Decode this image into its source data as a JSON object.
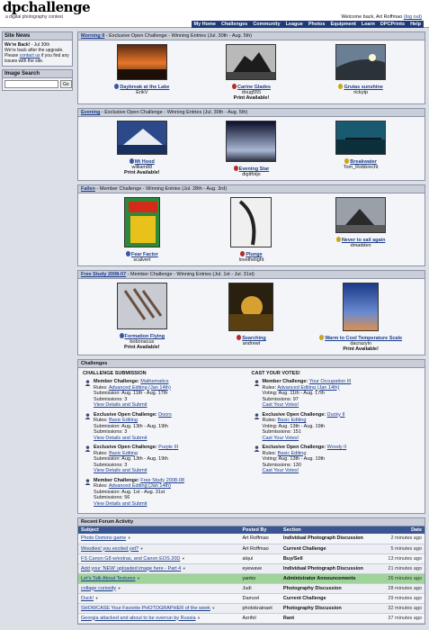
{
  "header": {
    "brand": "dpchallenge",
    "tagline": "a digital photography contest",
    "welcome": "Welcome back, Art Roffmao",
    "logout": "(log out)",
    "nav": [
      "My Home",
      "Challenges",
      "Community",
      "League",
      "Photos",
      "Equipment",
      "Learn",
      "DPCPrints",
      "Help"
    ]
  },
  "sidebar": {
    "news_title": "Site News",
    "news_head": "We're Back!",
    "news_date": " - Jul 30th",
    "news_body_1": "We're back after the upgrade. Please ",
    "news_link": "contact us",
    "news_body_2": " if you find any issues with the site.",
    "search_title": "Image Search",
    "search_button": "Go"
  },
  "sections": [
    {
      "title": "Morning II",
      "subtitle": " - Exclusive Open Challenge - Winning Entries (Jul. 30th - Aug. 5th)",
      "entries": [
        {
          "title": "Daybreak at the Lake",
          "author": "ErikV",
          "print": ""
        },
        {
          "title": "Carine Glades",
          "author": "doug555",
          "print": "Print Available!"
        },
        {
          "title": "Grutas sunshine",
          "author": "rickytp",
          "print": ""
        }
      ]
    },
    {
      "title": "Evening",
      "subtitle": " - Exclusive Open Challenge - Winning Entries (Jul. 30th - Aug. 5th)",
      "entries": [
        {
          "title": "Mt Hood",
          "author": "william88",
          "print": "Print Available!"
        },
        {
          "title": "Evening Star",
          "author": "digitfotjo",
          "print": ""
        },
        {
          "title": "Breakwater",
          "author": "Tom_Robbrecht",
          "print": ""
        }
      ]
    },
    {
      "title": "Fallen",
      "subtitle": " - Member Challenge - Winning Entries (Jul. 28th - Aug. 3rd)",
      "entries": [
        {
          "title": "Fear Factor",
          "author": "scalvert",
          "print": ""
        },
        {
          "title": "Plunge",
          "author": "lovethelight",
          "print": ""
        },
        {
          "title": "Never to sail again",
          "author": "dmadden",
          "print": ""
        }
      ]
    },
    {
      "title": "Free Study 2008-07",
      "subtitle": " - Member Challenge - Winning Entries (Jul. 1st - Jul. 31st)",
      "entries": [
        {
          "title": "Formation Flying",
          "author": "bobonacus",
          "print": "Print Available!"
        },
        {
          "title": "Searching",
          "author": "andrewt",
          "print": ""
        },
        {
          "title": "Warm to Cool Temperature Scale",
          "author": "dacrazyin",
          "print": "Print Available!"
        }
      ]
    }
  ],
  "challenges": {
    "title": "Challenges",
    "submission_head": "CHALLENGE SUBMISSION",
    "vote_head": "CAST YOUR VOTES!",
    "submission": [
      {
        "type": "Member Challenge: ",
        "name": "Mathematics",
        "rules_label": "Rules: ",
        "rules": "Advanced Editing (Jan 14th)",
        "period": "Submission: Aug. 11th - Aug. 17th",
        "count": "Submissions: 3",
        "link": "View Details and Submit"
      },
      {
        "type": "Exclusive Open Challenge: ",
        "name": "Doors",
        "rules_label": "Rules: ",
        "rules": "Basic Editing",
        "period": "Submission: Aug. 13th - Aug. 19th",
        "count": "Submissions: 3",
        "link": "View Details and Submit"
      },
      {
        "type": "Exclusive Open Challenge: ",
        "name": "Purple III",
        "rules_label": "Rules: ",
        "rules": "Basic Editing",
        "period": "Submission: Aug. 13th - Aug. 19th",
        "count": "Submissions: 3",
        "link": "View Details and Submit"
      },
      {
        "type": "Member Challenge: ",
        "name": "Free Study 2008-08",
        "rules_label": "Rules: ",
        "rules": "Advanced Editing (Jan 14th)",
        "period": "Submission: Aug. 1st - Aug. 31st",
        "count": "Submissions: 56",
        "link": "View Details and Submit"
      }
    ],
    "vote": [
      {
        "type": "Member Challenge: ",
        "name": "Your Occupation III",
        "rules_label": "Rules: ",
        "rules": "Advanced Editing (Jan 14th)",
        "period": "Voting: Aug. 11th - Aug. 17th",
        "count": "Submissions: 97",
        "link": "Cast Your Votes!"
      },
      {
        "type": "Exclusive Open Challenge: ",
        "name": "Ducky II",
        "rules_label": "Rules: ",
        "rules": "Basic Editing",
        "period": "Voting: Aug. 13th - Aug. 19th",
        "count": "Submissions: 151",
        "link": "Cast Your Votes!"
      },
      {
        "type": "Exclusive Open Challenge: ",
        "name": "Woody II",
        "rules_label": "Rules: ",
        "rules": "Basic Editing",
        "period": "Voting: Aug. 13th - Aug. 19th",
        "count": "Submissions: 130",
        "link": "Cast Your Votes!"
      }
    ]
  },
  "forum": {
    "title": "Recent Forum Activity",
    "columns": [
      "Subject",
      "Posted By",
      "Section",
      "Date"
    ],
    "rows": [
      {
        "subject": "Photo Domino game",
        "by": "Art Roffmao",
        "section": "Individual Photograph Discussion",
        "date": "2 minutes ago"
      },
      {
        "subject": "Woodies! you excited yet?",
        "by": "Art Roffmao",
        "section": "Current Challenge",
        "date": "5 minutes ago"
      },
      {
        "subject": "FS Canon G8 w/extras, and Canon EOS 20D",
        "by": "alqui",
        "section": "Buy/Sell",
        "date": "13 minutes ago"
      },
      {
        "subject": "Add your 'NEW' uploaded image here - Part 4",
        "by": "eyewave",
        "section": "Individual Photograph Discussion",
        "date": "21 minutes ago"
      },
      {
        "subject": "Let's Talk About Textures",
        "by": "yanko",
        "section": "Administrator Announcements",
        "date": "26 minutes ago"
      },
      {
        "subject": "collage curiosity",
        "by": "Judi",
        "section": "Photography Discussion",
        "date": "28 minutes ago"
      },
      {
        "subject": "Duck!",
        "by": "Damzel",
        "section": "Current Challenge",
        "date": "29 minutes ago"
      },
      {
        "subject": "SHOWCASE Your Favorite PHOTOGRAPHER of the week",
        "by": "photokrainaet",
        "section": "Photography Discussion",
        "date": "32 minutes ago"
      },
      {
        "subject": "Georgia attacked and about to be overrun by Russia",
        "by": "Azrifel",
        "section": "Rant",
        "date": "37 minutes ago"
      }
    ]
  }
}
